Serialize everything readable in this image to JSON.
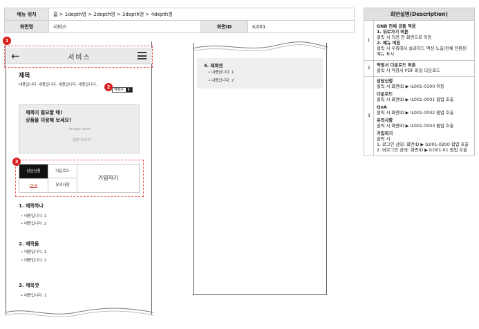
{
  "meta": {
    "menu_location_label": "메뉴 위치",
    "menu_location_value": "홈 > 1depth명 > 2depth명 > 3depth명 > 4depth명",
    "screen_name_label": "화면명",
    "screen_name_value": "서비스",
    "screen_id_label": "화면ID",
    "screen_id_value": "IL001"
  },
  "description": {
    "header": "화면설명(Description)",
    "rows": [
      {
        "num": "1",
        "blocks": [
          {
            "title": "GNB 전체 공통 적용",
            "lines": [
              "1. 뒤로가기 버튼",
              "클릭 시 직전 전 화면으로 이동",
              "2. 메뉴 버튼",
              "클릭 시 우측에서 슬라이드 액션 노출/전체 전환된 메뉴 표시"
            ]
          }
        ]
      },
      {
        "num": "2",
        "blocks": [
          {
            "title": "약정서 다운로드 버튼",
            "lines": [
              "클릭 시 약정서 PDF 파일 다운로드"
            ]
          }
        ]
      },
      {
        "num": "3",
        "blocks": [
          {
            "title": "상담신청",
            "lines": [
              "클릭 시 화면ID ▶ IL001-0100 이동"
            ]
          },
          {
            "title": "다운로드",
            "lines": [
              "클릭 시 화면ID ▶ IL001-0001 팝업 호출"
            ]
          },
          {
            "title": "QnA",
            "lines": [
              "클릭 시 화면ID ▶ IL001-0002 팝업 호출"
            ]
          },
          {
            "title": "유의사항",
            "lines": [
              "클릭 시 화면ID ▶ IL001-0003 팝업 호출"
            ]
          },
          {
            "title": "가입하기",
            "lines": [
              "클릭 시",
              "1. 로그인 상태: 화면ID ▶ IL001-0200 팝업 호출",
              "2. 비로그인 상태: 화면ID ▶ IL001-01 팝업 호출"
            ]
          }
        ]
      }
    ]
  },
  "phone": {
    "header_title": "서비스",
    "title": "제목",
    "intro": "내용입니다. 내용입니다. 내용입니다. 내용입니다.",
    "terms_button": "약정서",
    "terms_icon": "⬇",
    "banner_line1": "제목이 필요할 때!",
    "banner_line2": "상품을 이용해 보세요!",
    "banner_img1": "image area",
    "banner_img2": "관련 이미지",
    "btn_consult": "상담신청",
    "btn_download": "다운로드",
    "btn_qna": "QnA",
    "btn_notice": "유의사항",
    "btn_join": "가입하기",
    "sections": [
      {
        "title": "1. 제목하나",
        "items": [
          "내용입니다. 1",
          "내용입니다. 2"
        ]
      },
      {
        "title": "2. 제목둘",
        "items": [
          "내용입니다. 1",
          "내용입니다. 2"
        ]
      },
      {
        "title": "3. 제목셋",
        "items": [
          "내용입니다. 1"
        ]
      }
    ]
  },
  "mid": {
    "title": "4. 제목넷",
    "items": [
      "내용입니다. 1",
      "내용입니다. 2"
    ]
  },
  "markers": [
    "1",
    "2",
    "3"
  ],
  "colors": {
    "marker": "#d91c1c",
    "dash": "#e06060",
    "header_bg": "#e9e9e9"
  }
}
